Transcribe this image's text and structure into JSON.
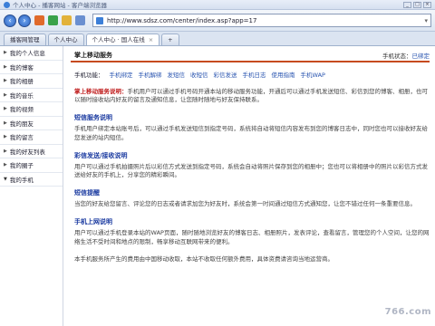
{
  "browser": {
    "window_title": "个人中心 - 播客网站 - 客户端浏览器",
    "address": "http://www.sdsz.com/center/index.asp?app=17",
    "tabs": [
      {
        "label": "播客网管理"
      },
      {
        "label": "个人中心"
      },
      {
        "label": "个人中心 · 国人在线",
        "active": true
      }
    ]
  },
  "sidebar": {
    "items": [
      {
        "label": "我的个人信息"
      },
      {
        "label": "我的博客"
      },
      {
        "label": "我的相册"
      },
      {
        "label": "我的音乐"
      },
      {
        "label": "我的视频"
      },
      {
        "label": "我的朋友"
      },
      {
        "label": "我的留言"
      },
      {
        "label": "我的好友列表"
      },
      {
        "label": "我的圈子"
      },
      {
        "label": "我的手机",
        "open": true
      }
    ]
  },
  "main": {
    "title": "掌上移动服务",
    "status_label": "手机状态：",
    "status_value": "已绑定",
    "subnav_prefix": "手机功能：",
    "subnav": [
      "手机绑定",
      "手机解绑",
      "发短信",
      "收短信",
      "彩信发送",
      "手机日志",
      "使用指南",
      "手机WAP"
    ],
    "intro_em": "掌上移动服务说明：",
    "intro_text": "手机用户可以通过手机号码开通本站的移动服务功能，开通后可以通过手机发送短信、彩信到您的博客、相册，也可以随时接收站内好友的留言及通知信息，让您随时随地与好友保持联系。",
    "sections": [
      {
        "title": "短信服务说明",
        "text": "手机用户绑定本站账号后，可以通过手机发送短信到指定号码，系统将自动将短信内容发布到您的博客日志中，同时您也可以接收好友给您发送的站内短信。"
      },
      {
        "title": "彩信发送/接收说明",
        "text": "用户可以通过手机拍摄照片后以彩信方式发送到指定号码，系统会自动将照片保存到您的相册中；您也可以将相册中的照片以彩信方式发送给好友的手机上，分享您的精彩瞬间。"
      },
      {
        "title": "短信提醒",
        "text": "当您的好友给您留言、评论您的日志或者请求加您为好友时，系统会第一时间通过短信方式通知您，让您不错过任何一条重要信息。"
      },
      {
        "title": "手机上网说明",
        "text": "用户可以通过手机登录本站的WAP页面，随时随地浏览好友的博客日志、相册照片，发表评论，查看留言，管理您的个人空间，让您的网络生活不受时间和地点的限制，畅享移动互联网带来的便利。"
      },
      {
        "title": "",
        "text": "本手机服务所产生的费用由中国移动收取，本站不收取任何额外费用，具体资费请咨询当地运营商。"
      }
    ]
  },
  "watermark": "766.com"
}
